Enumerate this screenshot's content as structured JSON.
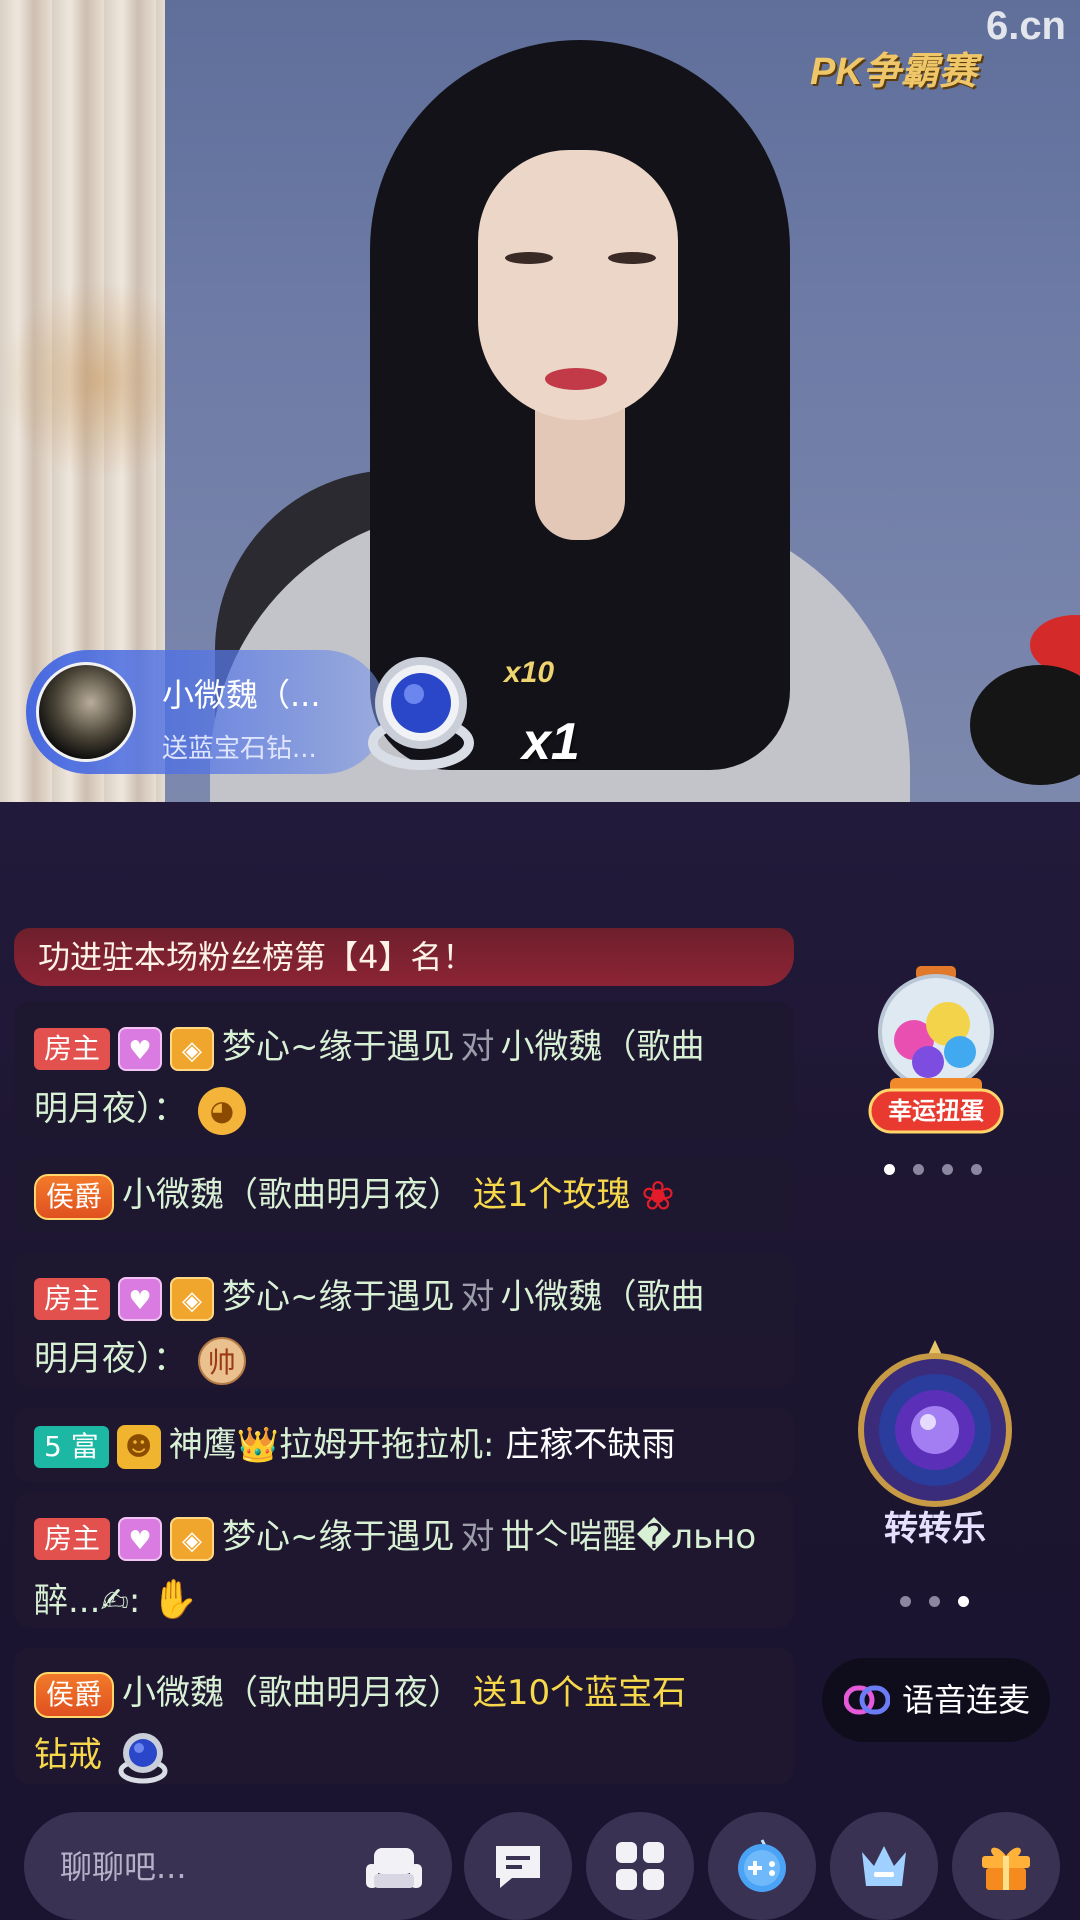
{
  "video": {
    "site_logo": "6.cn",
    "pk_banner": "PK争霸赛",
    "gift_notice": {
      "user": "小微魏（...",
      "desc": "送蓝宝石钻...",
      "multiplier_top": "x10",
      "multiplier_main": "x1"
    }
  },
  "chat": {
    "rank_banner": "功进驻本场粉丝榜第【4】名！",
    "messages": [
      {
        "badge": "房主",
        "sender": "梦心~缘于遇见",
        "connector": "对",
        "target_line1": "小微魏（歌曲",
        "target_line2": "明月夜）：",
        "emoji": "emoji-pray"
      },
      {
        "badge": "侯爵",
        "sender": "小微魏（歌曲明月夜）",
        "action": "送1个玫瑰"
      },
      {
        "badge": "房主",
        "sender": "梦心~缘于遇见",
        "connector": "对",
        "target_line1": "小微魏（歌曲",
        "target_line2": "明月夜）：",
        "emoji_text": "帅"
      },
      {
        "badge": "5 富",
        "sender": "神鹰👑拉姆开拖拉机:",
        "text": "庄稼不缺雨"
      },
      {
        "badge": "房主",
        "sender": "梦心~缘于遇见",
        "connector": "对",
        "target_line1": "丗亽啱醒�льно",
        "target_line2": "醉...✍:",
        "emoji": "emoji-ok-hand"
      },
      {
        "badge": "侯爵",
        "sender": "小微魏（歌曲明月夜）",
        "action_line1": "送10个蓝宝石",
        "action_line2": "钻戒"
      }
    ]
  },
  "widgets": {
    "gashapon_label": "幸运扭蛋",
    "spin_label": "转转乐",
    "voice_link_label": "语音连麦"
  },
  "bottom_bar": {
    "input_placeholder": "聊聊吧..."
  },
  "colors": {
    "chat_bg": "#1e1733",
    "name_text": "#d8f0d4",
    "gift_text": "#f7d84a",
    "host_badge": "#e2514d",
    "rich_badge": "#1db8a4",
    "bar_button": "#3a3253"
  }
}
